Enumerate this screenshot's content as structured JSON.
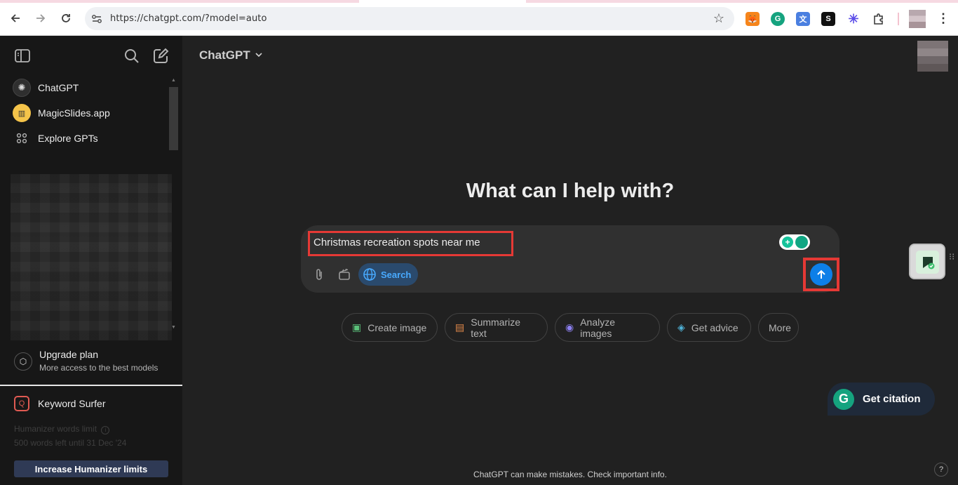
{
  "browser": {
    "url": "https://chatgpt.com/?model=auto",
    "back_icon": "arrow-left-icon",
    "forward_icon": "arrow-right-icon",
    "reload_icon": "reload-icon",
    "bookmark_icon": "star-icon",
    "extensions": [
      "metamask-icon",
      "grammarly-icon",
      "google-translate-icon",
      "sider-icon",
      "perplexity-icon",
      "puzzle-icon"
    ]
  },
  "sidebar": {
    "items": [
      {
        "label": "ChatGPT",
        "icon": "chatgpt-logo-icon"
      },
      {
        "label": "MagicSlides.app",
        "icon": "magicslides-icon"
      },
      {
        "label": "Explore GPTs",
        "icon": "grid-icon"
      }
    ],
    "upgrade": {
      "title": "Upgrade plan",
      "subtitle": "More access to the best models"
    },
    "keyword_surfer": "Keyword Surfer",
    "humanizer_limit": "Humanizer words limit",
    "humanizer_left": "500 words left until 31 Dec '24",
    "humanizer_button": "Increase Humanizer limits"
  },
  "main": {
    "model": "ChatGPT",
    "headline": "What can I help with?",
    "prompt": "Christmas recreation spots near me",
    "search_label": "Search",
    "suggestions": [
      {
        "label": "Create image",
        "icon": "image-icon",
        "color": "#5bc17a"
      },
      {
        "label": "Summarize text",
        "icon": "document-icon",
        "color": "#e2894a"
      },
      {
        "label": "Analyze images",
        "icon": "eye-icon",
        "color": "#8c7ff0"
      },
      {
        "label": "Get advice",
        "icon": "graduation-cap-icon",
        "color": "#4fb3d9"
      },
      {
        "label": "More",
        "icon": "",
        "color": ""
      }
    ],
    "citation_label": "Get citation",
    "footer": "ChatGPT can make mistakes. Check important info.",
    "help": "?"
  },
  "colors": {
    "accent_blue": "#0d7fe8",
    "highlight_red": "#e53935",
    "background": "#212121",
    "sidebar": "#171717"
  }
}
